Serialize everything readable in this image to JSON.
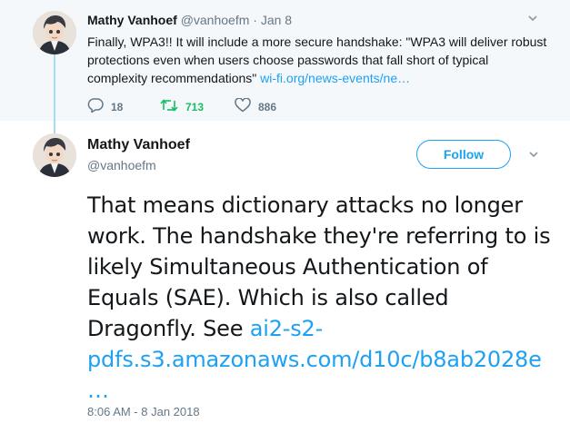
{
  "parent_tweet": {
    "name": "Mathy Vanhoef",
    "handle": "@vanhoefm",
    "dot": "·",
    "time": "Jan 8",
    "text": "Finally, WPA3!! It will include a more secure handshake: \"WPA3 will deliver robust protections even when users choose passwords that fall short of typical complexity recommendations\"",
    "link": "wi-fi.org/news-events/ne…",
    "replies": "18",
    "retweets": "713",
    "likes": "886"
  },
  "main_tweet": {
    "name": "Mathy Vanhoef",
    "handle": "@vanhoefm",
    "follow_label": "Follow",
    "text": "That means dictionary attacks no longer work. The handshake they're referring to is likely Simultaneous Authentication of Equals (SAE). Which is also called Dragonfly. See",
    "link": "ai2-s2-pdfs.s3.amazonaws.com/d10c/b8ab2028e …",
    "timestamp": "8:06 AM - 8 Jan 2018"
  },
  "colors": {
    "link": "#1da1f2",
    "retweet_active": "#17bf63",
    "secondary_text": "#657786",
    "thread_line": "#a6dcf8"
  },
  "icons": [
    "avatar",
    "chevron-down-icon",
    "reply-icon",
    "retweet-icon",
    "heart-icon"
  ]
}
